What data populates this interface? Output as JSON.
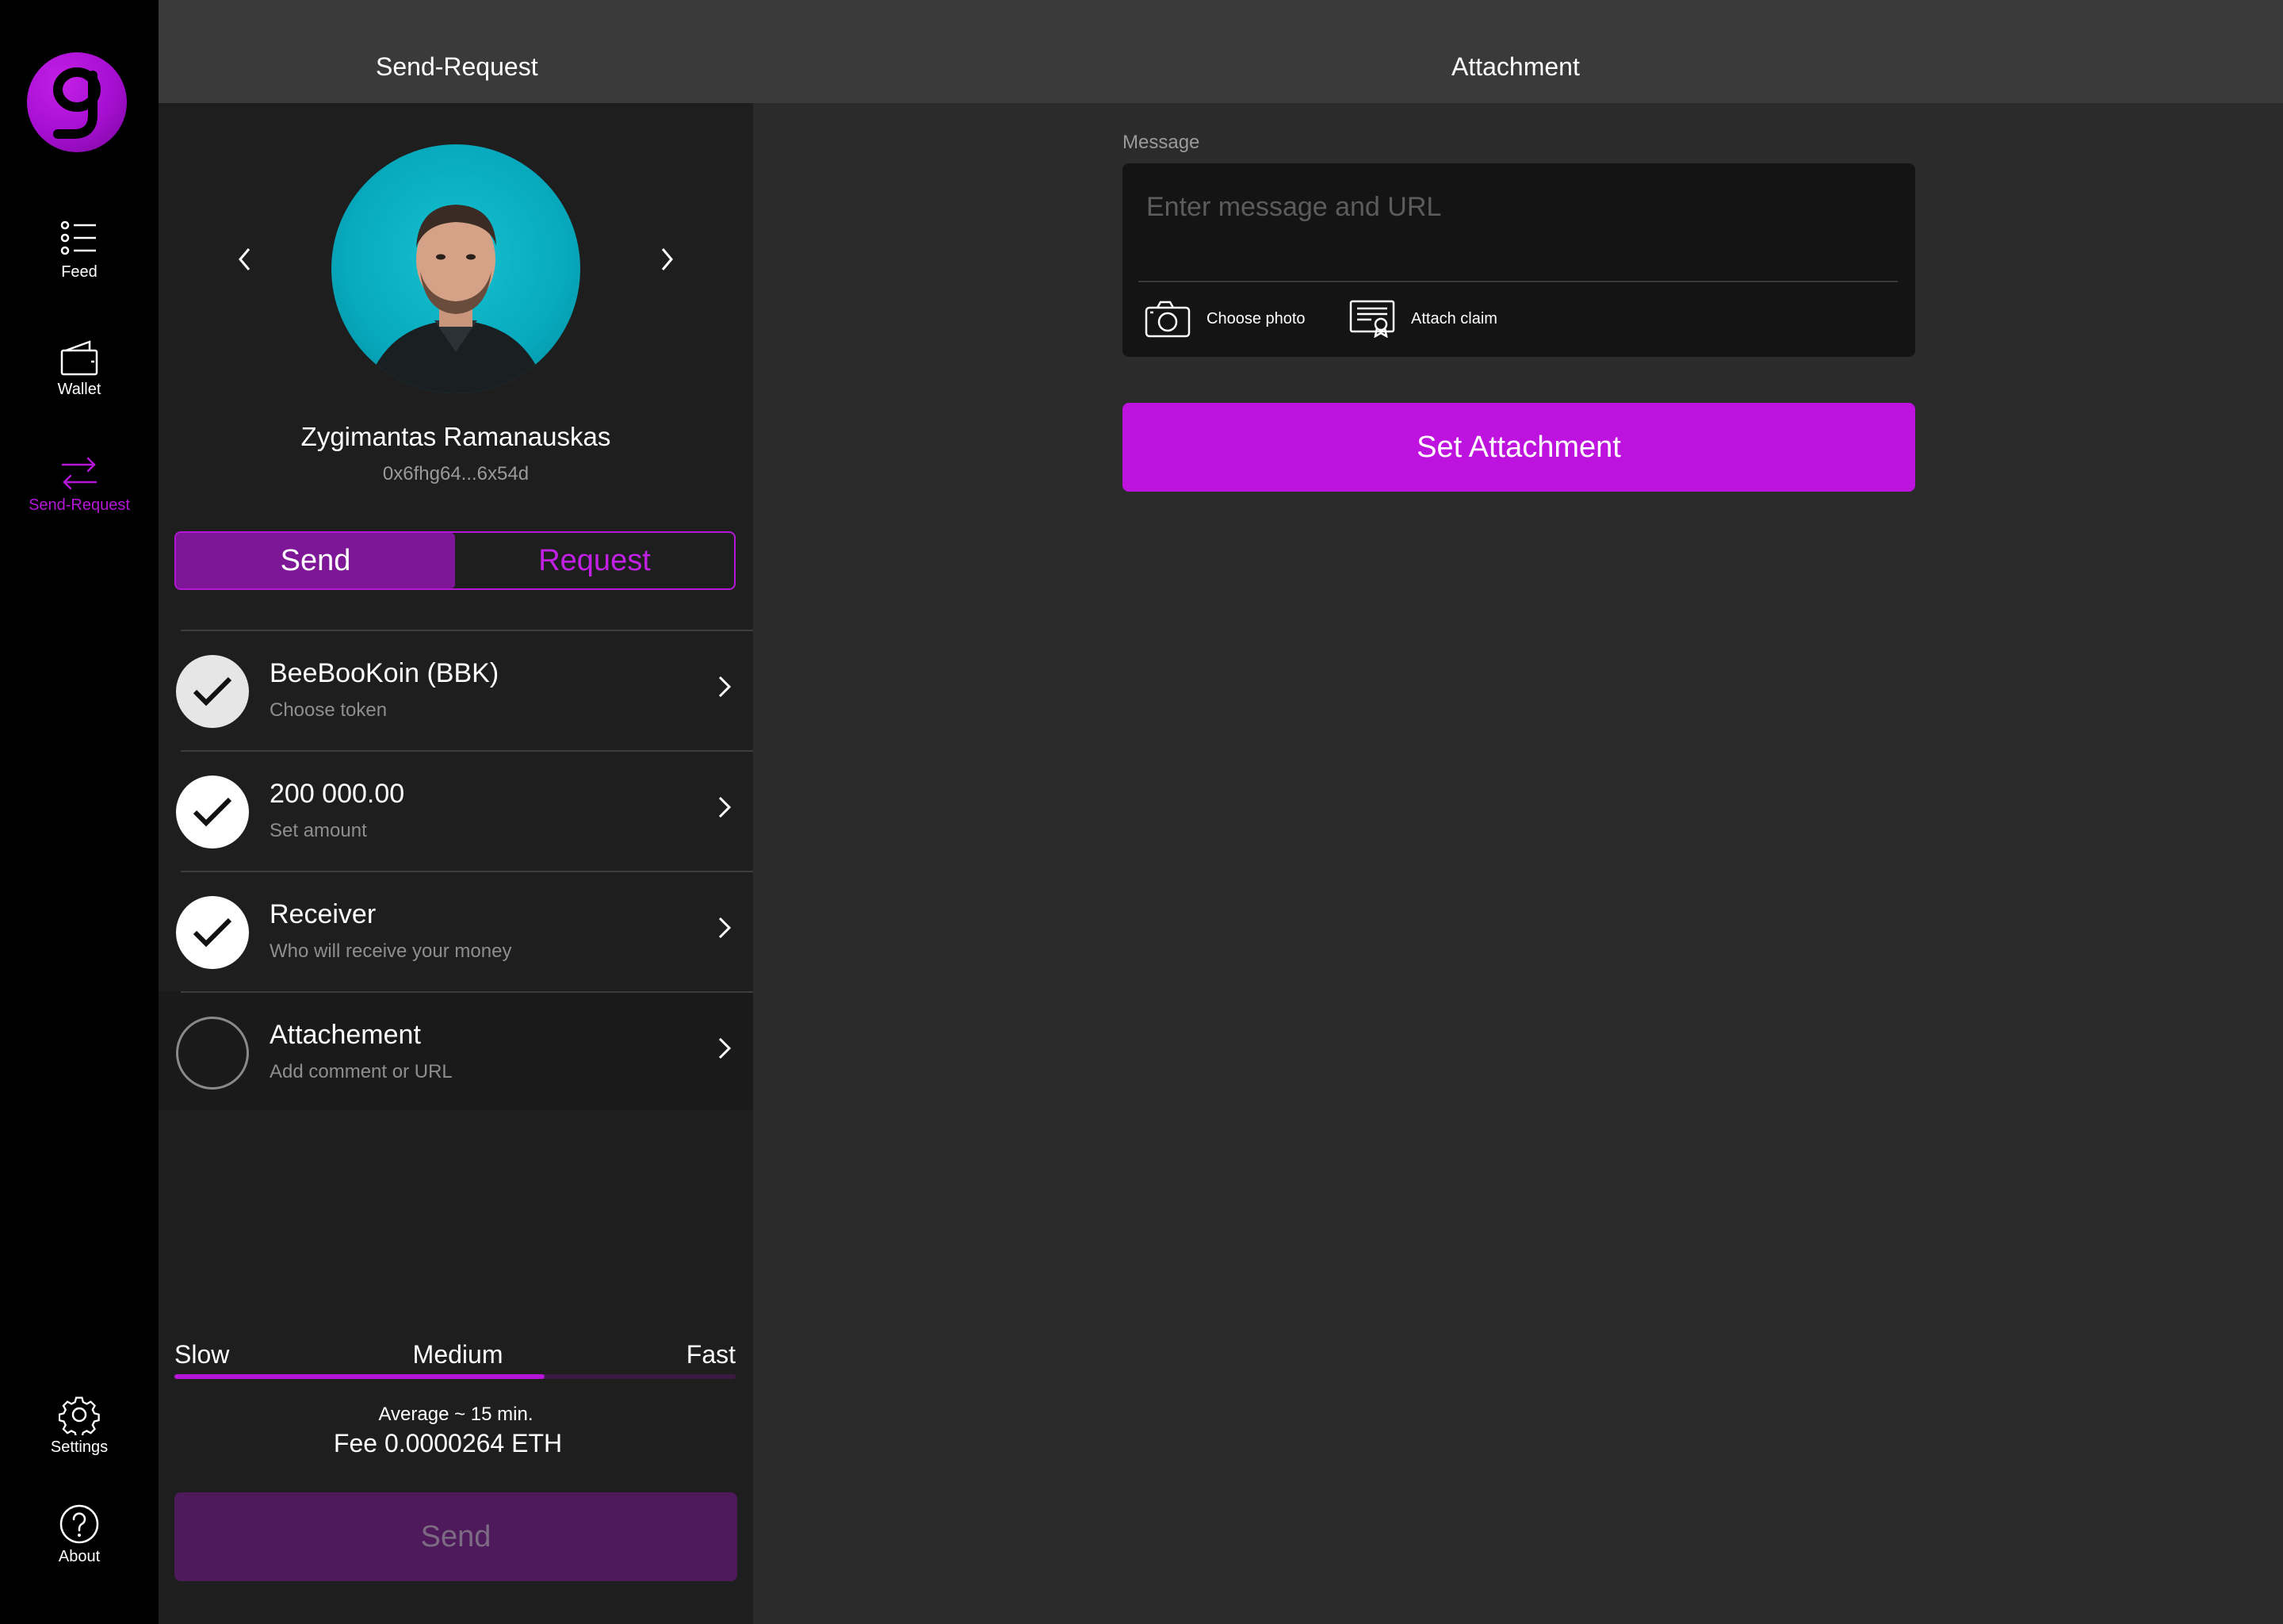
{
  "app": {
    "logo_letter": "g",
    "accent_color": "#b417d6"
  },
  "sidebar": {
    "items": [
      {
        "label": "Feed",
        "icon": "list-icon"
      },
      {
        "label": "Wallet",
        "icon": "wallet-icon"
      },
      {
        "label": "Send-Request",
        "icon": "transfer-arrows-icon",
        "active": true
      },
      {
        "label": "Settings",
        "icon": "gear-icon"
      },
      {
        "label": "About",
        "icon": "help-circle-icon"
      }
    ]
  },
  "header": {
    "left_title": "Send-Request",
    "right_title": "Attachment"
  },
  "contact": {
    "name": "Zygimantas Ramanauskas",
    "address": "0x6fhg64...6x54d"
  },
  "mode_toggle": {
    "send_label": "Send",
    "request_label": "Request",
    "selected": "Send"
  },
  "steps": [
    {
      "title": "BeeBooKoin (BBK)",
      "subtitle": "Choose token",
      "completed": true
    },
    {
      "title": "200 000.00",
      "subtitle": "Set amount",
      "completed": true
    },
    {
      "title": "Receiver",
      "subtitle": "Who will receive your money",
      "completed": true
    },
    {
      "title": "Attachement",
      "subtitle": "Add comment or URL",
      "completed": false
    }
  ],
  "speed": {
    "labels": [
      "Slow",
      "Medium",
      "Fast"
    ],
    "selected": "Medium",
    "level": 0.66,
    "average_text": "Average ~ 15 min.",
    "fee_text": "Fee 0.0000264 ETH"
  },
  "send_button_label": "Send",
  "attachment": {
    "message_label": "Message",
    "message_value": "",
    "message_placeholder": "Enter message and URL",
    "choose_photo_label": "Choose photo",
    "attach_claim_label": "Attach claim",
    "set_button_label": "Set Attachment"
  }
}
